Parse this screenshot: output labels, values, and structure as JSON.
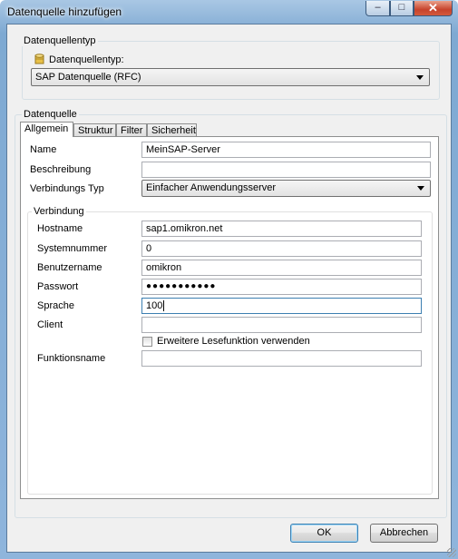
{
  "window": {
    "title": "Datenquelle hinzufügen",
    "min_glyph": "–",
    "max_glyph": "□",
    "close_glyph": "✕"
  },
  "datasource_type_group": {
    "label": "Datenquellentyp",
    "field_label": "Datenquellentyp:",
    "selected": "SAP Datenquelle (RFC)"
  },
  "datasource_group": {
    "label": "Datenquelle"
  },
  "tabs": [
    {
      "label": "Allgemein",
      "active": true
    },
    {
      "label": "Struktur",
      "active": false
    },
    {
      "label": "Filter",
      "active": false
    },
    {
      "label": "Sicherheit",
      "active": false
    }
  ],
  "general": {
    "name_label": "Name",
    "name_value": "MeinSAP-Server",
    "description_label": "Beschreibung",
    "description_value": "",
    "conn_type_label": "Verbindungs Typ",
    "conn_type_value": "Einfacher Anwendungsserver"
  },
  "connection": {
    "group_label": "Verbindung",
    "hostname_label": "Hostname",
    "hostname_value": "sap1.omikron.net",
    "sysnum_label": "Systemnummer",
    "sysnum_value": "0",
    "user_label": "Benutzername",
    "user_value": "omikron",
    "password_label": "Passwort",
    "password_value": "●●●●●●●●●●●",
    "language_label": "Sprache",
    "language_value": "100",
    "client_label": "Client",
    "client_value": "",
    "ext_read_label": "Erweitere Lesefunktion verwenden",
    "ext_read_checked": false,
    "function_label": "Funktionsname",
    "function_value": ""
  },
  "buttons": {
    "ok": "OK",
    "cancel": "Abbrechen"
  }
}
